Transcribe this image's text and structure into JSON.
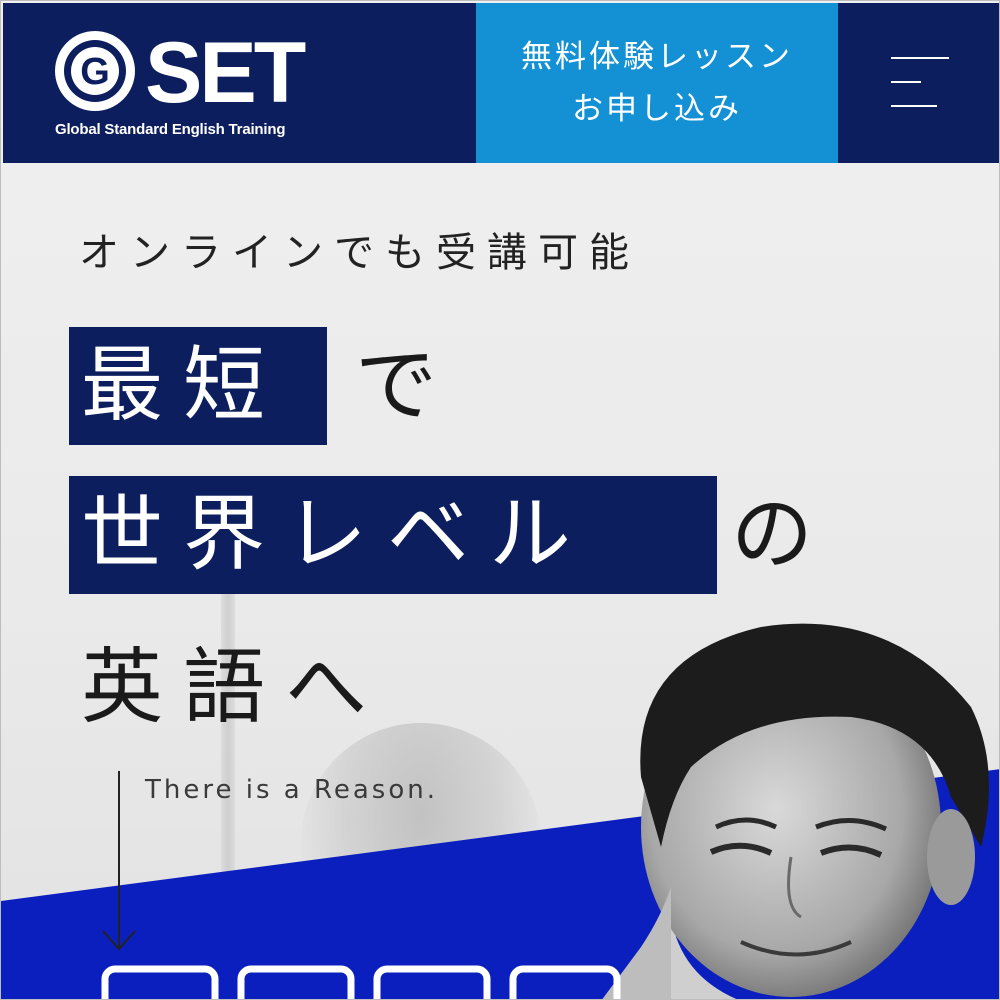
{
  "header": {
    "logo_text": "SET",
    "logo_letter": "G",
    "logo_tagline": "Global Standard English Training",
    "cta_line1": "無料体験レッスン",
    "cta_line2": "お申し込み",
    "colors": {
      "navy": "#0d1e5e",
      "cta_blue": "#1491d4",
      "accent_blue": "#0b1fbf"
    }
  },
  "hero": {
    "subtitle": "オンラインでも受講可能",
    "headline_line1_box": "最短",
    "headline_line1_rest": "で",
    "headline_line2_box": "世界レベル",
    "headline_line2_rest": "の",
    "headline_line3": "英語へ",
    "reason": "There is a Reason."
  },
  "icons": {
    "menu": "hamburger-menu-icon",
    "arrow": "arrow-down-icon"
  }
}
